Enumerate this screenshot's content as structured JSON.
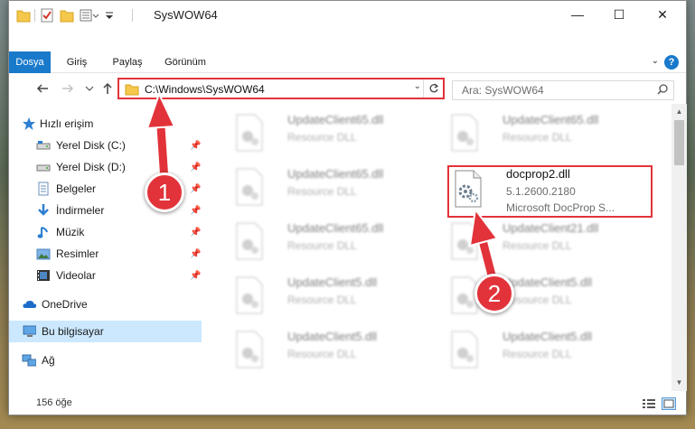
{
  "window": {
    "title": "SysWOW64",
    "minimize_glyph": "—",
    "maximize_glyph": "☐",
    "close_glyph": "✕"
  },
  "ribbon": {
    "tabs": [
      "Dosya",
      "Giriş",
      "Paylaş",
      "Görünüm"
    ],
    "help_label": "?"
  },
  "navbar": {
    "address": "C:\\Windows\\SysWOW64",
    "search_placeholder": "Ara: SysWOW64"
  },
  "sidebar": {
    "items": [
      {
        "label": "Hızlı erişim",
        "icon": "star-icon"
      },
      {
        "label": "Yerel Disk (C:)",
        "icon": "drive-icon"
      },
      {
        "label": "Yerel Disk (D:)",
        "icon": "drive-icon"
      },
      {
        "label": "Belgeler",
        "icon": "documents-icon"
      },
      {
        "label": "İndirmeler",
        "icon": "download-icon"
      },
      {
        "label": "Müzik",
        "icon": "music-icon"
      },
      {
        "label": "Resimler",
        "icon": "pictures-icon"
      },
      {
        "label": "Videolar",
        "icon": "videos-icon"
      },
      {
        "label": "OneDrive",
        "icon": "cloud-icon"
      },
      {
        "label": "Bu bilgisayar",
        "icon": "computer-icon"
      },
      {
        "label": "Ağ",
        "icon": "network-icon"
      }
    ]
  },
  "files": {
    "left": [
      {
        "name": "UpdateClient65.dll",
        "type": "Resource DLL"
      },
      {
        "name": "UpdateClient65.dll",
        "type": "Resource DLL"
      },
      {
        "name": "UpdateClient65.dll",
        "type": "Resource DLL"
      },
      {
        "name": "UpdateClient5.dll",
        "type": "Resource DLL"
      },
      {
        "name": "UpdateClient5.dll",
        "type": "Resource DLL"
      }
    ],
    "right": [
      {
        "name": "UpdateClient65.dll",
        "type": "Resource DLL"
      },
      {
        "name": "UpdateClient21.dll",
        "type": "Resource DLL"
      },
      {
        "name": "UpdateClient5.dll",
        "type": "Resource DLL"
      },
      {
        "name": "UpdateClient5.dll",
        "type": "Resource DLL"
      }
    ],
    "highlighted": {
      "name": "docprop2.dll",
      "version": "5.1.2600.2180",
      "description": "Microsoft DocProp S..."
    }
  },
  "status": {
    "item_count": "156 öğe"
  },
  "annotations": {
    "step1": "1",
    "step2": "2",
    "color": "#e2333a"
  }
}
